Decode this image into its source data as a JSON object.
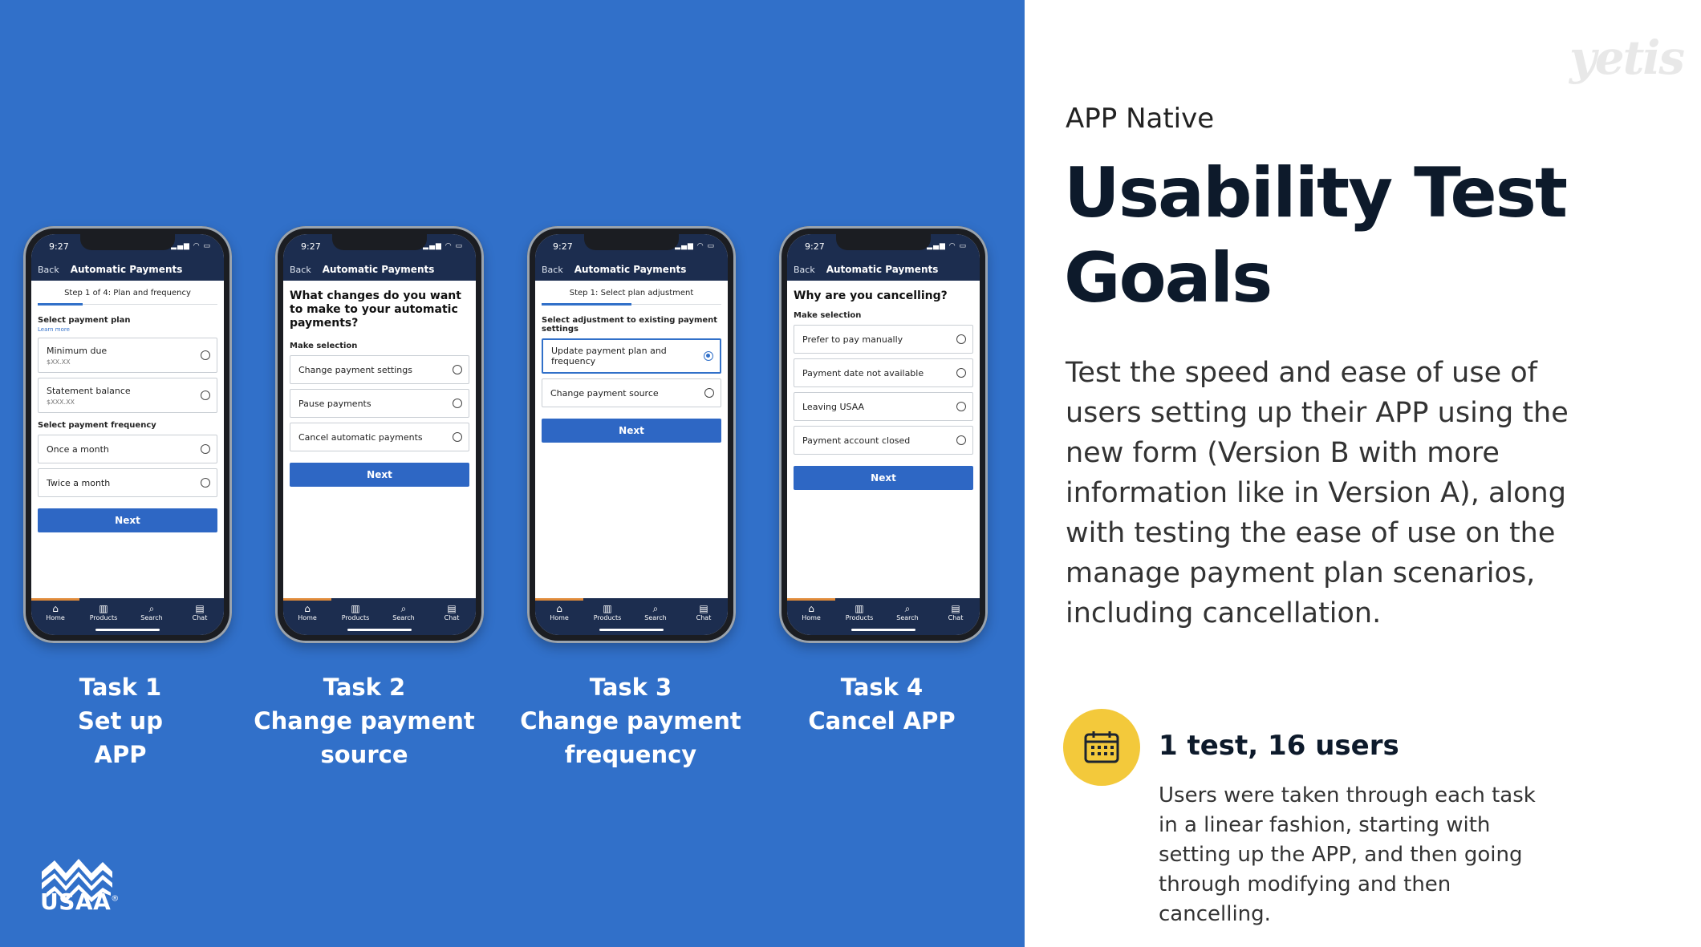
{
  "brand": {
    "logo_text": "USAA",
    "watermark": "yetis",
    "accent": "#3170C9",
    "icon_accent": "#f3c93b"
  },
  "phone_common": {
    "time": "9:27",
    "status_icons": "▂▄▆ ◠ ▭",
    "back": "Back",
    "title": "Automatic Payments",
    "tabs": [
      {
        "icon": "⌂",
        "label": "Home"
      },
      {
        "icon": "▥",
        "label": "Products"
      },
      {
        "icon": "⌕",
        "label": "Search"
      },
      {
        "icon": "▤",
        "label": "Chat"
      }
    ]
  },
  "phones": [
    {
      "step": "Step 1 of 4: Plan and frequency",
      "section1": "Select payment plan",
      "learn_more": "Learn more",
      "plan_options": [
        {
          "label": "Minimum due",
          "sub": "$XX.XX"
        },
        {
          "label": "Statement balance",
          "sub": "$XXX.XX"
        }
      ],
      "section2": "Select payment frequency",
      "freq_options": [
        "Once a month",
        "Twice a month"
      ],
      "next": "Next"
    },
    {
      "question": "What changes do you want to make to your automatic payments?",
      "section": "Make selection",
      "options": [
        "Change payment settings",
        "Pause payments",
        "Cancel automatic payments"
      ],
      "next": "Next"
    },
    {
      "step": "Step 1: Select plan adjustment",
      "section": "Select adjustment to existing payment settings",
      "options": [
        "Update payment plan and frequency",
        "Change payment source"
      ],
      "selected_index": 0,
      "next": "Next"
    },
    {
      "question": "Why are you cancelling?",
      "section": "Make selection",
      "options": [
        "Prefer to pay manually",
        "Payment date not available",
        "Leaving USAA",
        "Payment account closed"
      ],
      "next": "Next"
    }
  ],
  "tasks": [
    {
      "number": "Task 1",
      "line1": "Set up",
      "line2": "APP"
    },
    {
      "number": "Task 2",
      "line1": "Change payment",
      "line2": "source"
    },
    {
      "number": "Task 3",
      "line1": "Change payment",
      "line2": "frequency"
    },
    {
      "number": "Task 4",
      "line1": "Cancel APP",
      "line2": ""
    }
  ],
  "right": {
    "eyebrow": "APP Native",
    "headline": "Usability Test Goals",
    "body": "Test the speed and ease of use of users setting up their APP using the new form (Version B with more information like in Version A), along with testing the ease of use on the manage payment plan scenarios, including cancellation.",
    "stat_icon": "calendar-icon",
    "stat": "1 test, 16 users",
    "stat_desc": "Users were taken through each task in a linear fashion, starting with setting up the APP, and then going through modifying and then cancelling."
  }
}
